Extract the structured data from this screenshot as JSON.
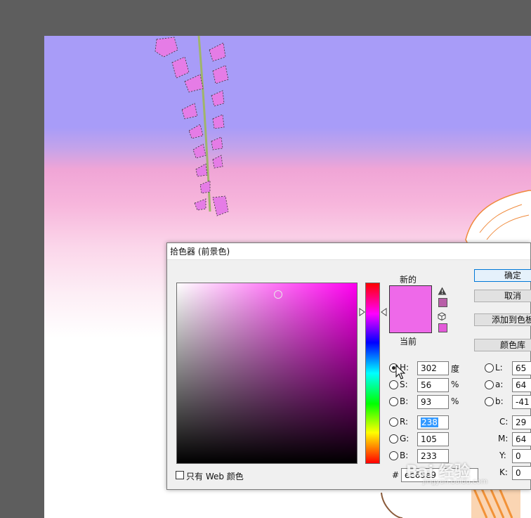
{
  "dialog": {
    "title": "拾色器 (前景色)",
    "new_label": "新的",
    "current_label": "当前",
    "buttons": {
      "ok": "确定",
      "cancel": "取消",
      "add_to_swatches": "添加到色板",
      "color_libraries": "颜色库"
    },
    "colors": {
      "new": "#ee69e9",
      "gamut_warning_swatch": "#b85fa8",
      "web_safe_swatch": "#e35ad9"
    },
    "hsb": {
      "h": {
        "label": "H:",
        "value": "302",
        "unit": "度"
      },
      "s": {
        "label": "S:",
        "value": "56",
        "unit": "%"
      },
      "b": {
        "label": "B:",
        "value": "93",
        "unit": "%"
      }
    },
    "rgb": {
      "r": {
        "label": "R:",
        "value": "238"
      },
      "g": {
        "label": "G:",
        "value": "105"
      },
      "b": {
        "label": "B:",
        "value": "233"
      }
    },
    "lab": {
      "l": {
        "label": "L:",
        "value": "65"
      },
      "a": {
        "label": "a:",
        "value": "64"
      },
      "b": {
        "label": "b:",
        "value": "-41"
      }
    },
    "cmyk": {
      "c": {
        "label": "C:",
        "value": "29"
      },
      "m": {
        "label": "M:",
        "value": "64"
      },
      "y": {
        "label": "Y:",
        "value": "0"
      },
      "k": {
        "label": "K:",
        "value": "0"
      }
    },
    "hex": {
      "label": "#",
      "value": "ee69e9"
    },
    "web_only_label": "只有 Web 颜色",
    "selected_mode": "H"
  },
  "watermark": {
    "text": "Bai 经验",
    "url": "jingyan.baidu.com"
  }
}
